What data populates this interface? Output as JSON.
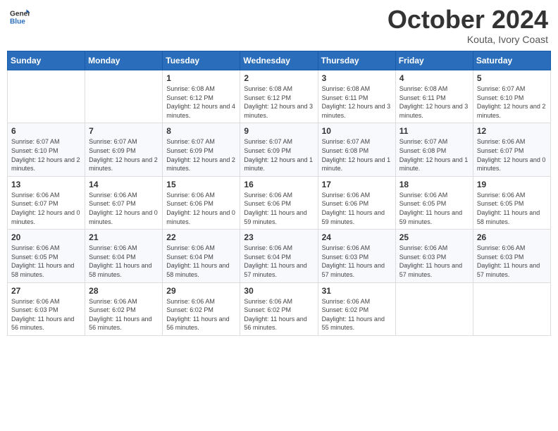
{
  "header": {
    "logo_general": "General",
    "logo_blue": "Blue",
    "month": "October 2024",
    "location": "Kouta, Ivory Coast"
  },
  "days_of_week": [
    "Sunday",
    "Monday",
    "Tuesday",
    "Wednesday",
    "Thursday",
    "Friday",
    "Saturday"
  ],
  "weeks": [
    [
      {
        "num": "",
        "detail": ""
      },
      {
        "num": "",
        "detail": ""
      },
      {
        "num": "1",
        "detail": "Sunrise: 6:08 AM\nSunset: 6:12 PM\nDaylight: 12 hours and 4 minutes."
      },
      {
        "num": "2",
        "detail": "Sunrise: 6:08 AM\nSunset: 6:12 PM\nDaylight: 12 hours and 3 minutes."
      },
      {
        "num": "3",
        "detail": "Sunrise: 6:08 AM\nSunset: 6:11 PM\nDaylight: 12 hours and 3 minutes."
      },
      {
        "num": "4",
        "detail": "Sunrise: 6:08 AM\nSunset: 6:11 PM\nDaylight: 12 hours and 3 minutes."
      },
      {
        "num": "5",
        "detail": "Sunrise: 6:07 AM\nSunset: 6:10 PM\nDaylight: 12 hours and 2 minutes."
      }
    ],
    [
      {
        "num": "6",
        "detail": "Sunrise: 6:07 AM\nSunset: 6:10 PM\nDaylight: 12 hours and 2 minutes."
      },
      {
        "num": "7",
        "detail": "Sunrise: 6:07 AM\nSunset: 6:09 PM\nDaylight: 12 hours and 2 minutes."
      },
      {
        "num": "8",
        "detail": "Sunrise: 6:07 AM\nSunset: 6:09 PM\nDaylight: 12 hours and 2 minutes."
      },
      {
        "num": "9",
        "detail": "Sunrise: 6:07 AM\nSunset: 6:09 PM\nDaylight: 12 hours and 1 minute."
      },
      {
        "num": "10",
        "detail": "Sunrise: 6:07 AM\nSunset: 6:08 PM\nDaylight: 12 hours and 1 minute."
      },
      {
        "num": "11",
        "detail": "Sunrise: 6:07 AM\nSunset: 6:08 PM\nDaylight: 12 hours and 1 minute."
      },
      {
        "num": "12",
        "detail": "Sunrise: 6:06 AM\nSunset: 6:07 PM\nDaylight: 12 hours and 0 minutes."
      }
    ],
    [
      {
        "num": "13",
        "detail": "Sunrise: 6:06 AM\nSunset: 6:07 PM\nDaylight: 12 hours and 0 minutes."
      },
      {
        "num": "14",
        "detail": "Sunrise: 6:06 AM\nSunset: 6:07 PM\nDaylight: 12 hours and 0 minutes."
      },
      {
        "num": "15",
        "detail": "Sunrise: 6:06 AM\nSunset: 6:06 PM\nDaylight: 12 hours and 0 minutes."
      },
      {
        "num": "16",
        "detail": "Sunrise: 6:06 AM\nSunset: 6:06 PM\nDaylight: 11 hours and 59 minutes."
      },
      {
        "num": "17",
        "detail": "Sunrise: 6:06 AM\nSunset: 6:06 PM\nDaylight: 11 hours and 59 minutes."
      },
      {
        "num": "18",
        "detail": "Sunrise: 6:06 AM\nSunset: 6:05 PM\nDaylight: 11 hours and 59 minutes."
      },
      {
        "num": "19",
        "detail": "Sunrise: 6:06 AM\nSunset: 6:05 PM\nDaylight: 11 hours and 58 minutes."
      }
    ],
    [
      {
        "num": "20",
        "detail": "Sunrise: 6:06 AM\nSunset: 6:05 PM\nDaylight: 11 hours and 58 minutes."
      },
      {
        "num": "21",
        "detail": "Sunrise: 6:06 AM\nSunset: 6:04 PM\nDaylight: 11 hours and 58 minutes."
      },
      {
        "num": "22",
        "detail": "Sunrise: 6:06 AM\nSunset: 6:04 PM\nDaylight: 11 hours and 58 minutes."
      },
      {
        "num": "23",
        "detail": "Sunrise: 6:06 AM\nSunset: 6:04 PM\nDaylight: 11 hours and 57 minutes."
      },
      {
        "num": "24",
        "detail": "Sunrise: 6:06 AM\nSunset: 6:03 PM\nDaylight: 11 hours and 57 minutes."
      },
      {
        "num": "25",
        "detail": "Sunrise: 6:06 AM\nSunset: 6:03 PM\nDaylight: 11 hours and 57 minutes."
      },
      {
        "num": "26",
        "detail": "Sunrise: 6:06 AM\nSunset: 6:03 PM\nDaylight: 11 hours and 57 minutes."
      }
    ],
    [
      {
        "num": "27",
        "detail": "Sunrise: 6:06 AM\nSunset: 6:03 PM\nDaylight: 11 hours and 56 minutes."
      },
      {
        "num": "28",
        "detail": "Sunrise: 6:06 AM\nSunset: 6:02 PM\nDaylight: 11 hours and 56 minutes."
      },
      {
        "num": "29",
        "detail": "Sunrise: 6:06 AM\nSunset: 6:02 PM\nDaylight: 11 hours and 56 minutes."
      },
      {
        "num": "30",
        "detail": "Sunrise: 6:06 AM\nSunset: 6:02 PM\nDaylight: 11 hours and 56 minutes."
      },
      {
        "num": "31",
        "detail": "Sunrise: 6:06 AM\nSunset: 6:02 PM\nDaylight: 11 hours and 55 minutes."
      },
      {
        "num": "",
        "detail": ""
      },
      {
        "num": "",
        "detail": ""
      }
    ]
  ]
}
